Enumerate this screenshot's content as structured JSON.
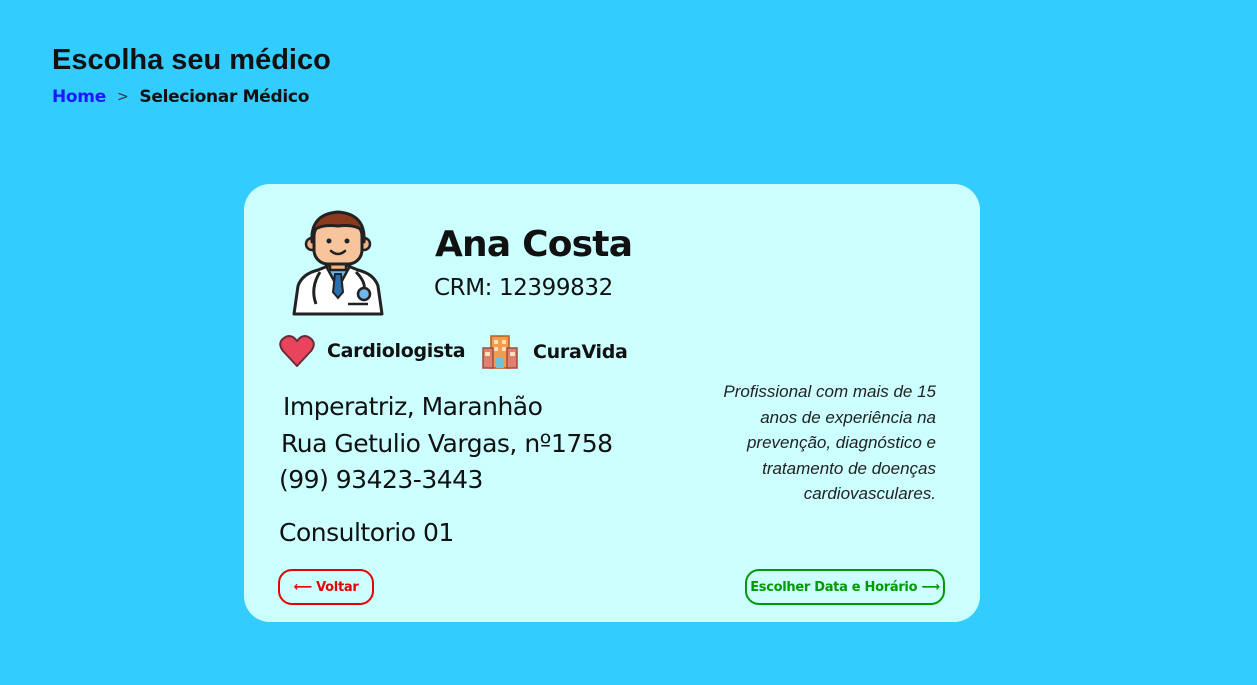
{
  "header": {
    "title": "Escolha seu médico",
    "breadcrumb": {
      "home": "Home",
      "separator": ">",
      "current": "Selecionar Médico"
    }
  },
  "doctor": {
    "avatar_icon": "doctor-avatar-icon",
    "name": "Ana Costa",
    "crm": "CRM: 12399832",
    "specialty": {
      "icon": "heart-icon",
      "label": "Cardiologista"
    },
    "clinic": {
      "icon": "building-icon",
      "label": "CuraVida"
    },
    "city": "Imperatriz, Maranhão",
    "street": "Rua Getulio Vargas, nº1758",
    "phone": "(99) 93423-3443",
    "room": "Consultorio 01",
    "bio": "Profissional com mais de 15 anos de experiência na prevenção, diagnóstico e tratamento de doenças cardiovasculares."
  },
  "actions": {
    "back_label": "⟵ Voltar",
    "next_label": "Escolher Data e Horário ⟶"
  },
  "colors": {
    "background": "#33ccff",
    "card": "#ccffff",
    "link": "#1a1aff",
    "back": "#e60000",
    "next": "#009900"
  }
}
